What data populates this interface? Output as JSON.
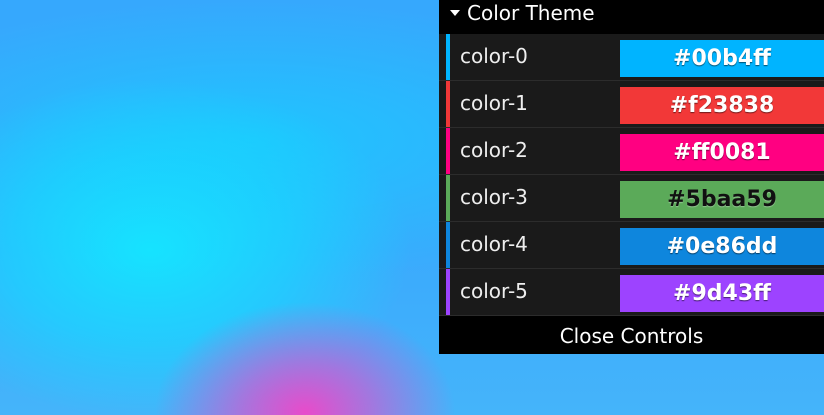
{
  "panel": {
    "folder_title": "Color Theme",
    "close_label": "Close Controls",
    "colors": [
      {
        "name": "color-0",
        "value": "#00b4ff",
        "hex": "#00b4ff",
        "text_dark": false
      },
      {
        "name": "color-1",
        "value": "#f23838",
        "hex": "#f23838",
        "text_dark": false
      },
      {
        "name": "color-2",
        "value": "#ff0081",
        "hex": "#ff0081",
        "text_dark": false
      },
      {
        "name": "color-3",
        "value": "#5baa59",
        "hex": "#5baa59",
        "text_dark": true
      },
      {
        "name": "color-4",
        "value": "#0e86dd",
        "hex": "#0e86dd",
        "text_dark": false
      },
      {
        "name": "color-5",
        "value": "#9d43ff",
        "hex": "#9d43ff",
        "text_dark": false
      }
    ]
  }
}
